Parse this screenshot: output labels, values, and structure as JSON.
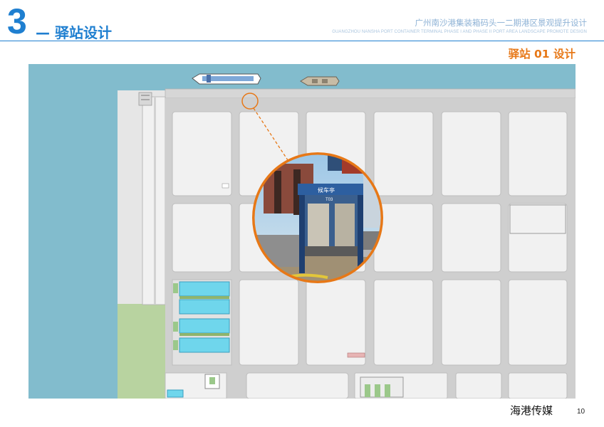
{
  "header": {
    "section_number": "3",
    "section_title": "— 驿站设计",
    "project_title_cn": "广州南沙港集装箱码头一二期港区景观提升设计",
    "project_title_en": "GUANGZHOU NANSHA PORT CONTAINER TERMINAL PHASE I AND PHASE II PORT AREA LANDSCAPE PROMOTE DESIGN"
  },
  "subtitle": "驿站 01 设计",
  "photo": {
    "sign_text": "候车亭",
    "sign_code": "T03"
  },
  "footer": {
    "brand": "海港传媒",
    "page_number": "10"
  },
  "colors": {
    "accent_blue": "#1f7fd0",
    "accent_orange": "#e77817",
    "water": "#82bccd",
    "green_area": "#b8d3a0"
  },
  "icons": [
    "ship-icon",
    "boat-icon"
  ]
}
